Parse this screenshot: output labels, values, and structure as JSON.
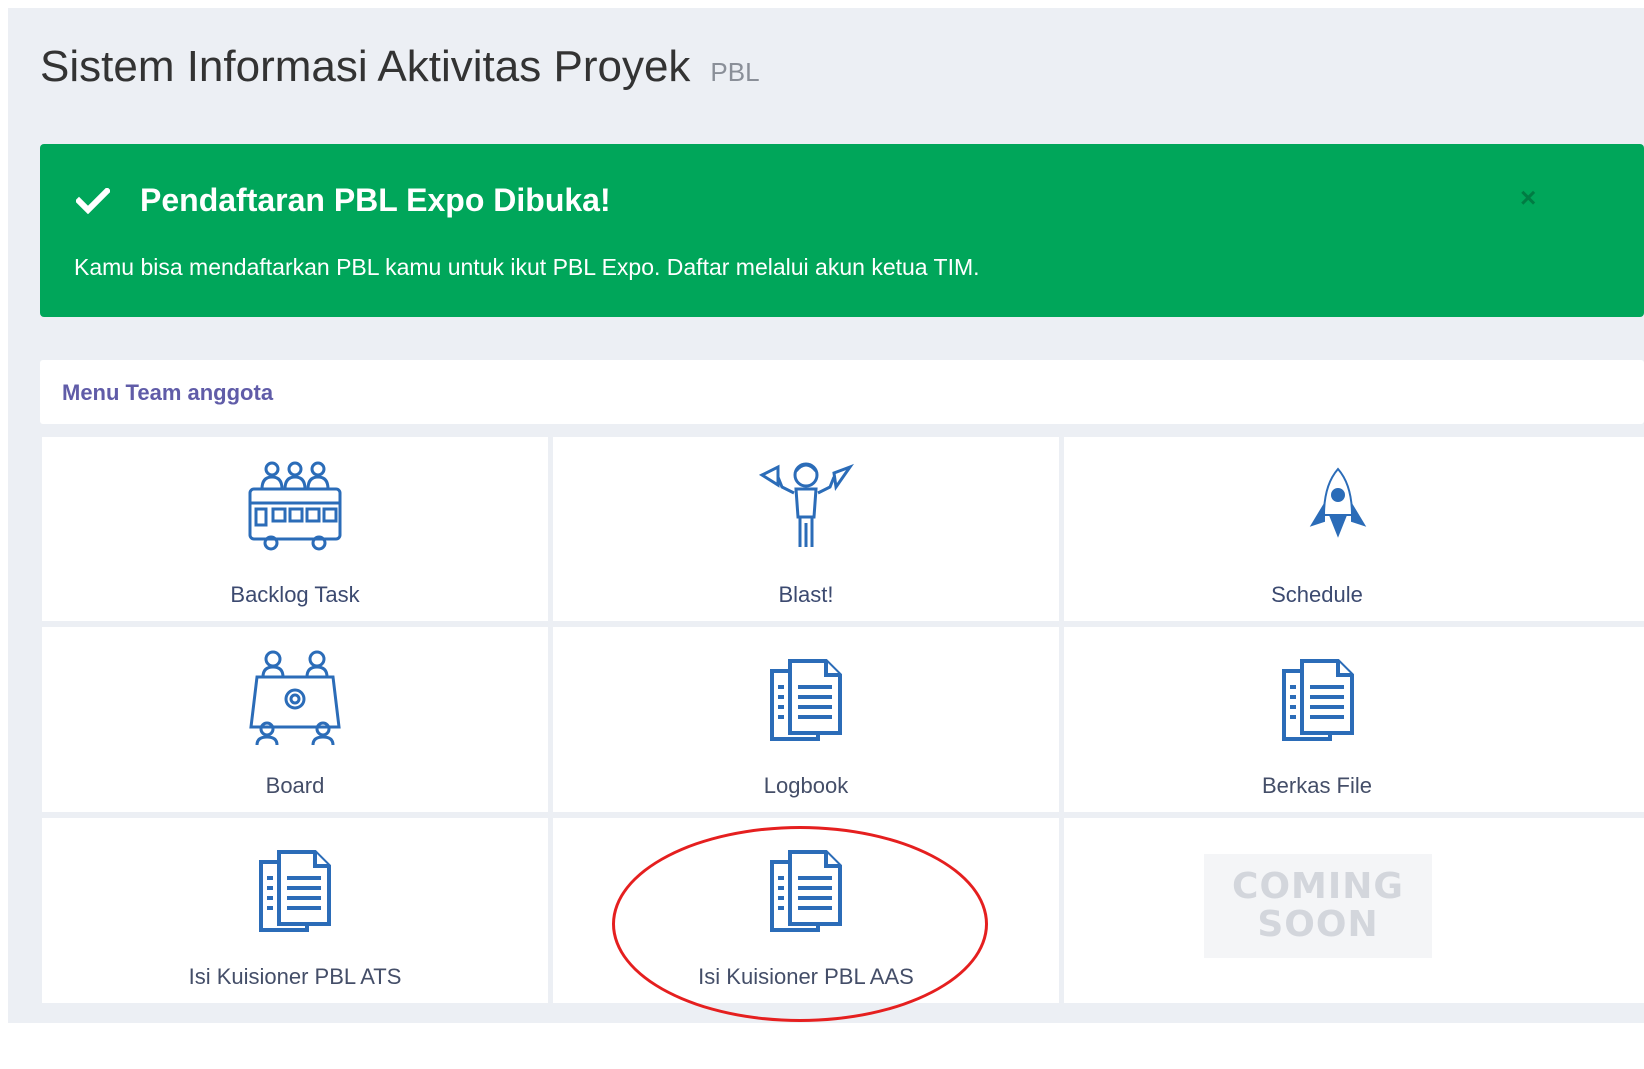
{
  "header": {
    "title": "Sistem Informasi Aktivitas Proyek",
    "subtitle": "PBL"
  },
  "alert": {
    "title": "Pendaftaran PBL Expo Dibuka!",
    "message": "Kamu bisa mendaftarkan PBL kamu untuk ikut PBL Expo. Daftar melalui akun ketua TIM.",
    "close_symbol": "×",
    "check_icon": "check-icon",
    "background_color": "#00a65a"
  },
  "menu": {
    "title": "Menu Team anggota",
    "title_color": "#605ca8",
    "tiles": [
      {
        "label": "Backlog Task",
        "icon": "team-bus-icon"
      },
      {
        "label": "Blast!",
        "icon": "megaphone-person-icon"
      },
      {
        "label": "Schedule",
        "icon": "rocket-icon"
      },
      {
        "label": "Board",
        "icon": "meeting-board-icon"
      },
      {
        "label": "Logbook",
        "icon": "document-icon"
      },
      {
        "label": "Berkas File",
        "icon": "document-icon"
      },
      {
        "label": "Isi Kuisioner PBL ATS",
        "icon": "document-icon"
      },
      {
        "label": "Isi Kuisioner PBL AAS",
        "icon": "document-icon"
      },
      {
        "label": "",
        "icon": "coming-soon-image"
      }
    ],
    "coming_soon_line1": "COMING",
    "coming_soon_line2": "SOON"
  },
  "annotation": {
    "highlight_color": "#e51f1f",
    "highlighted_tile": "Isi Kuisioner PBL AAS"
  }
}
